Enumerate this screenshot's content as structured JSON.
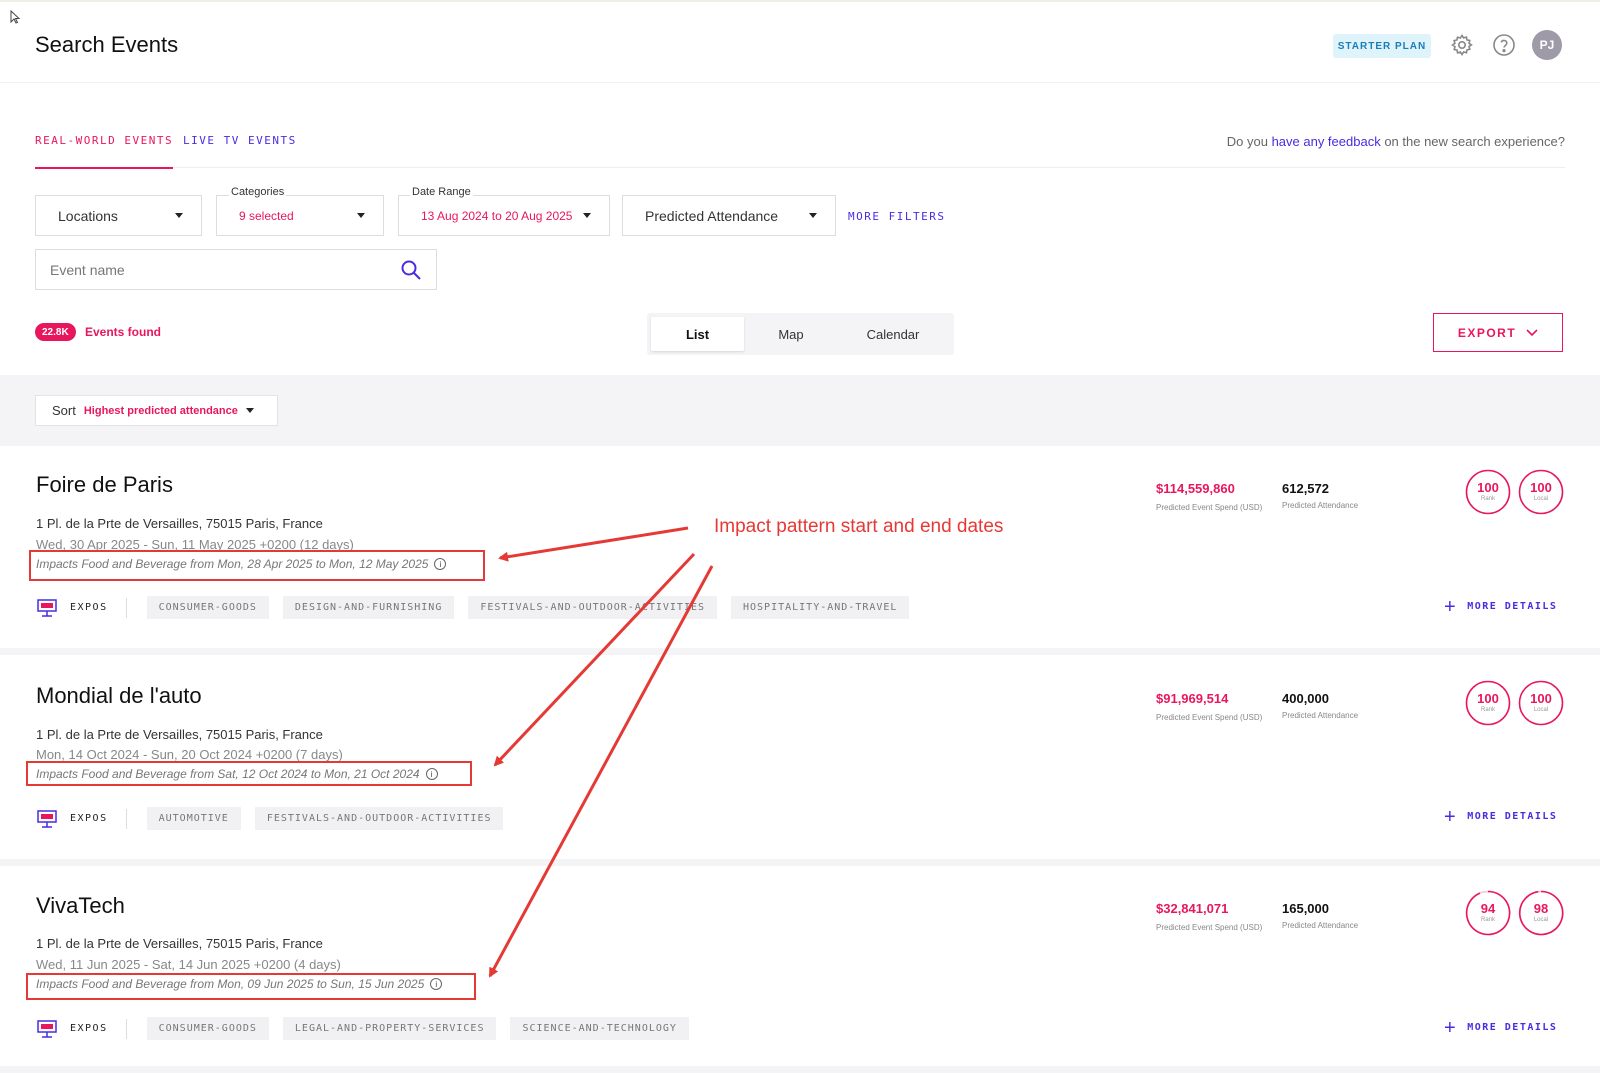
{
  "header": {
    "title": "Search Events",
    "plan_badge": "STARTER PLAN",
    "avatar_initials": "PJ",
    "icons": [
      "gear-icon",
      "help-icon"
    ]
  },
  "tabs": {
    "real_world": "REAL-WORLD EVENTS",
    "live_tv": "LIVE TV EVENTS",
    "feedback_prefix": "Do you ",
    "feedback_link": "have any feedback",
    "feedback_suffix": " on the new search experience?"
  },
  "filters": {
    "locations": "Locations",
    "categories_label": "Categories",
    "categories_value": "9 selected",
    "date_range_label": "Date Range",
    "date_range_value": "13 Aug 2024 to 20 Aug 2025",
    "attendance": "Predicted Attendance",
    "more_filters": "MORE FILTERS"
  },
  "search": {
    "placeholder": "Event name"
  },
  "results": {
    "count": "22.8K",
    "label": "Events found"
  },
  "view_switch": {
    "list": "List",
    "map": "Map",
    "calendar": "Calendar",
    "active": "List"
  },
  "export": {
    "label": "EXPORT"
  },
  "sort": {
    "label": "Sort",
    "value": "Highest predicted attendance"
  },
  "colors": {
    "accent": "#e8175d",
    "link": "#4a2ce0",
    "annotation": "#e53935"
  },
  "events": [
    {
      "title": "Foire de Paris",
      "address": "1 Pl. de la Prte de Versailles, 75015 Paris, France",
      "dates": "Wed, 30 Apr 2025 - Sun, 11 May 2025 +0200 (12 days)",
      "impact": "Impacts Food and Beverage from Mon, 28 Apr 2025 to Mon, 12 May 2025",
      "category": "EXPOS",
      "tags": [
        "CONSUMER-GOODS",
        "DESIGN-AND-FURNISHING",
        "FESTIVALS-AND-OUTDOOR-ACTIVITIES",
        "HOSPITALITY-AND-TRAVEL"
      ],
      "spend": "$114,559,860",
      "spend_label": "Predicted Event Spend (USD)",
      "attendance": "612,572",
      "attendance_label": "Predicted Attendance",
      "rank": "100",
      "rank_label": "Rank",
      "local_rank": "100",
      "local_label": "Local",
      "more_details": "MORE DETAILS"
    },
    {
      "title": "Mondial de l'auto",
      "address": "1 Pl. de la Prte de Versailles, 75015 Paris, France",
      "dates": "Mon, 14 Oct 2024 - Sun, 20 Oct 2024 +0200 (7 days)",
      "impact": "Impacts Food and Beverage from Sat, 12 Oct 2024 to Mon, 21 Oct 2024",
      "category": "EXPOS",
      "tags": [
        "AUTOMOTIVE",
        "FESTIVALS-AND-OUTDOOR-ACTIVITIES"
      ],
      "spend": "$91,969,514",
      "spend_label": "Predicted Event Spend (USD)",
      "attendance": "400,000",
      "attendance_label": "Predicted Attendance",
      "rank": "100",
      "rank_label": "Rank",
      "local_rank": "100",
      "local_label": "Local",
      "more_details": "MORE DETAILS"
    },
    {
      "title": "VivaTech",
      "address": "1 Pl. de la Prte de Versailles, 75015 Paris, France",
      "dates": "Wed, 11 Jun 2025 - Sat, 14 Jun 2025 +0200 (4 days)",
      "impact": "Impacts Food and Beverage from Mon, 09 Jun 2025 to Sun, 15 Jun 2025",
      "category": "EXPOS",
      "tags": [
        "CONSUMER-GOODS",
        "LEGAL-AND-PROPERTY-SERVICES",
        "SCIENCE-AND-TECHNOLOGY"
      ],
      "spend": "$32,841,071",
      "spend_label": "Predicted Event Spend (USD)",
      "attendance": "165,000",
      "attendance_label": "Predicted Attendance",
      "rank": "94",
      "rank_label": "Rank",
      "local_rank": "98",
      "local_label": "Local",
      "more_details": "MORE DETAILS"
    }
  ],
  "annotation": {
    "text": "Impact pattern start and end dates"
  }
}
